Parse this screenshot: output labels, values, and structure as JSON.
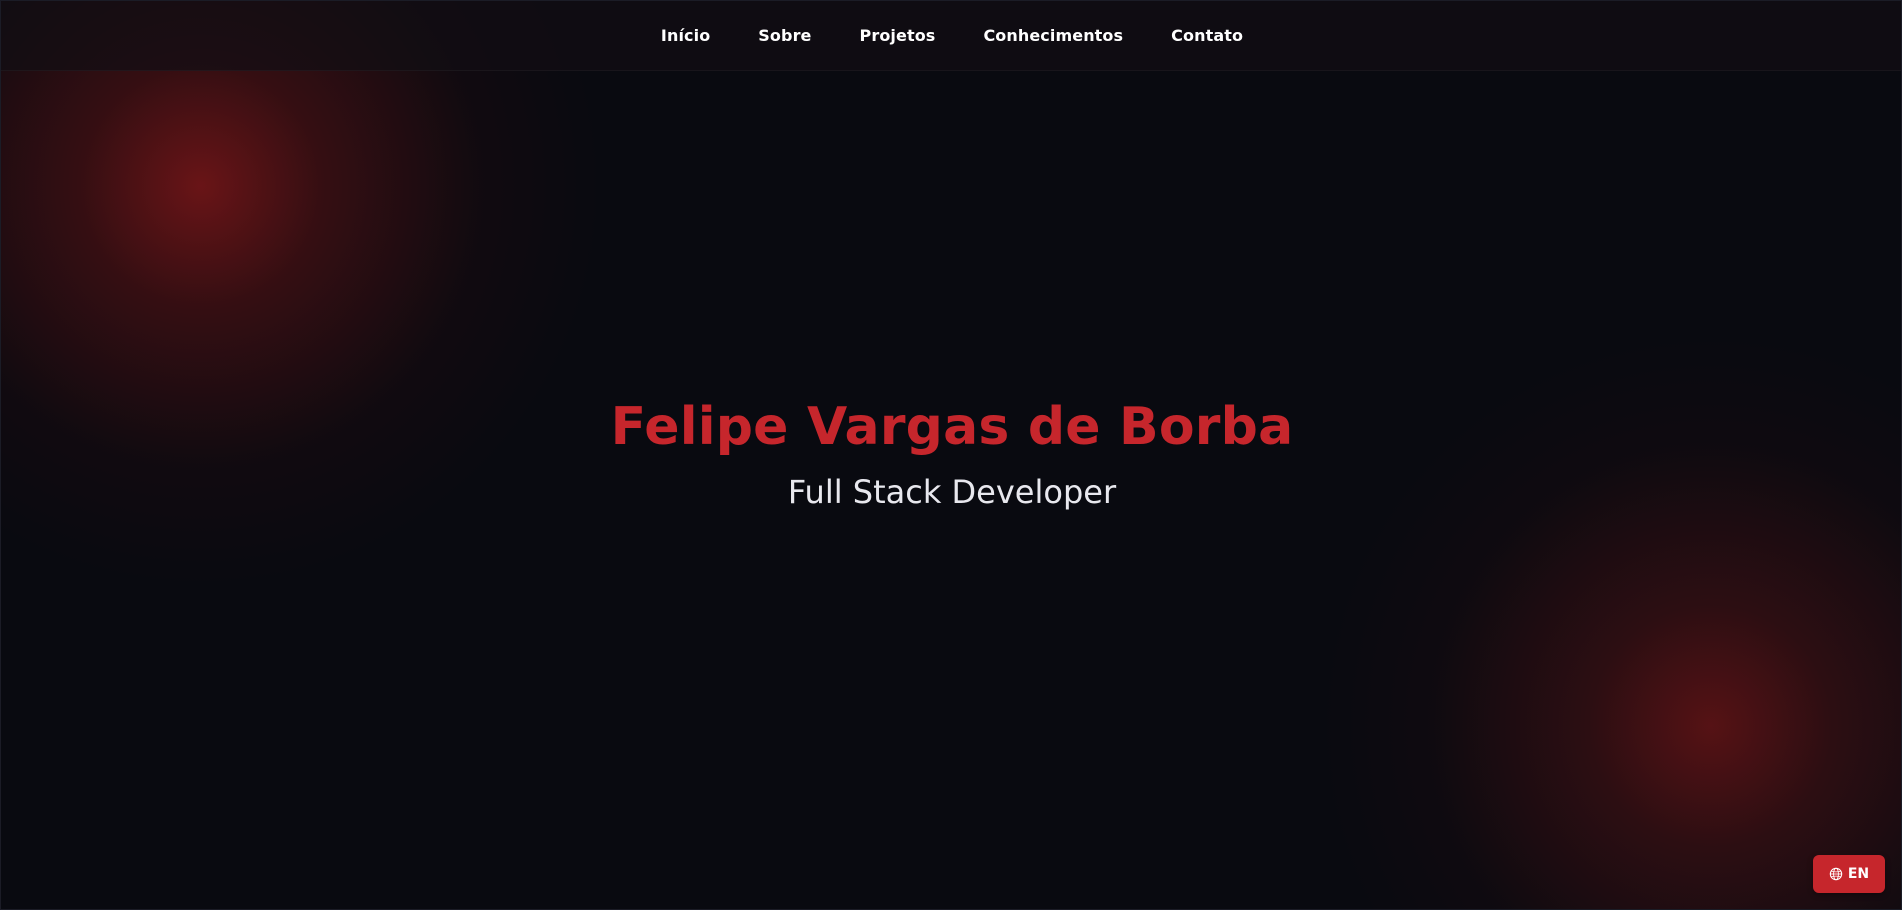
{
  "navigation": {
    "items": [
      {
        "label": "Início"
      },
      {
        "label": "Sobre"
      },
      {
        "label": "Projetos"
      },
      {
        "label": "Conhecimentos"
      },
      {
        "label": "Contato"
      }
    ]
  },
  "hero": {
    "name": "Felipe Vargas de Borba",
    "role": "Full Stack Developer"
  },
  "language_toggle": {
    "label": "EN",
    "icon": "globe-icon"
  },
  "colors": {
    "background": "#090a10",
    "accent": "#c6262c",
    "text": "#ffffff",
    "subtitle": "#e8e8ee"
  }
}
